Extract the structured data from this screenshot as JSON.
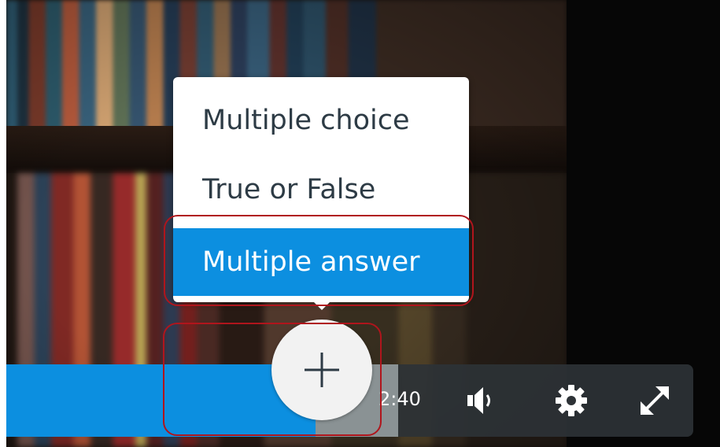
{
  "player": {
    "time": "2:40",
    "played_fraction": 0.45
  },
  "add_question_menu": {
    "items": [
      {
        "label": "Multiple choice",
        "selected": false
      },
      {
        "label": "True or False",
        "selected": false
      },
      {
        "label": "Multiple answer",
        "selected": true
      }
    ]
  },
  "icons": {
    "add": "plus-icon",
    "volume": "volume-icon",
    "settings": "gear-icon",
    "fullscreen": "expand-icon"
  },
  "colors": {
    "accent": "#0c8fe0",
    "highlight": "#b0151c",
    "control_bar": "#2d3236"
  }
}
